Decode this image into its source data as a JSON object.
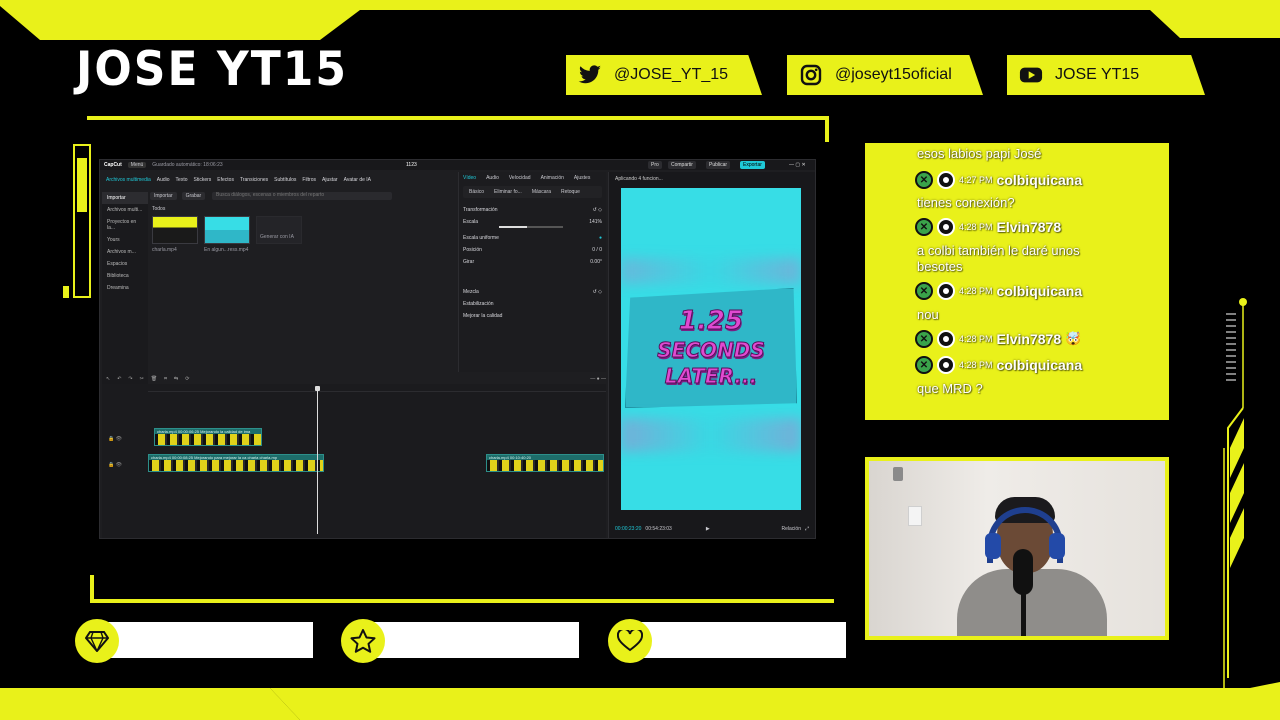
{
  "brand": {
    "title": "JOSE YT15"
  },
  "socials": [
    {
      "icon": "twitter-icon",
      "handle": "@JOSE_YT_15"
    },
    {
      "icon": "instagram-icon",
      "handle": "@joseyt15oficial"
    },
    {
      "icon": "youtube-icon",
      "handle": "JOSE YT15"
    }
  ],
  "editor": {
    "app": "CapCut",
    "menu": "Menú",
    "saved": "Guardado automático: 18:06:23",
    "project": "1123",
    "top_buttons": [
      "Pro",
      "Compartir",
      "Publicar",
      "Exportar"
    ],
    "toolbar": [
      "Archivos multimedia",
      "Audio",
      "Texto",
      "Stickers",
      "Efectos",
      "Transiciones",
      "Subtítulos",
      "Filtros",
      "Ajustar",
      "Avatar de IA"
    ],
    "sidebar": [
      "Importar",
      "Archivos multi...",
      "Proyectos en la...",
      "Yours",
      "Archivos m...",
      "Espacios",
      "Biblioteca",
      "Dreamina"
    ],
    "media_tabs": [
      "Importar",
      "Grabar"
    ],
    "media_filter": "Todos",
    "search_placeholder": "Busca diálogos, escenas o miembros del reparto",
    "thumbs": [
      {
        "badge": "Añadido",
        "label": "charla.mp4"
      },
      {
        "badge": "Añadido",
        "label": "En algun...ress.mp4"
      },
      {
        "badge": "",
        "label": "Generar con IA"
      }
    ],
    "props_tabs": [
      "Vídeo",
      "Audio",
      "Velocidad",
      "Animación",
      "Ajustes"
    ],
    "props_sub": [
      "Básico",
      "Eliminar fo...",
      "Máscara",
      "Retoque"
    ],
    "props_rows": {
      "transform": "Transformación",
      "scale": "Escala",
      "scale_value": "141%",
      "uniform": "Escala uniforme",
      "position": "Posición",
      "pos_x": "0",
      "pos_y": "0",
      "rotate": "Girar",
      "rotate_value": "0.00°",
      "blend": "Mezcla",
      "stabilize": "Estabilización",
      "enhance": "Mejorar la calidad"
    },
    "player_header": "Aplicando 4 funcion...",
    "preview_text": [
      "1.25",
      "SECONDS",
      "LATER..."
    ],
    "timecode": "00:00:23:20",
    "duration": "00:54:23:03",
    "ratio": "Relación",
    "clips": [
      {
        "label": "charla.mp4   00:00:06:25   Mejorando la calidad de ima"
      },
      {
        "label": "charla.mp4   00:00:08:25   Mejorando para mejorar la ca   charla  charla.mp"
      },
      {
        "label": "charla.mp4   00:10:40:20"
      }
    ]
  },
  "chat": {
    "cut_message": "esos labios papi José",
    "messages": [
      {
        "time": "4:27 PM",
        "user": "colbiquicana",
        "text": "tienes conexión?",
        "emoji": ""
      },
      {
        "time": "4:28 PM",
        "user": "Elvin7878",
        "text": "a colbi también le daré unos besotes",
        "emoji": ""
      },
      {
        "time": "4:28 PM",
        "user": "colbiquicana",
        "text": "nou",
        "emoji": ""
      },
      {
        "time": "4:28 PM",
        "user": "Elvin7878",
        "text": "",
        "emoji": "🤯"
      },
      {
        "time": "4:28 PM",
        "user": "colbiquicana",
        "text": "que MRD ?",
        "emoji": ""
      }
    ]
  },
  "bottom_bars": [
    {
      "icon": "diamond-icon"
    },
    {
      "icon": "star-icon"
    },
    {
      "icon": "heart-icon"
    }
  ],
  "colors": {
    "accent": "#e9f11a",
    "background": "#000000",
    "cyan": "#37dde6"
  }
}
